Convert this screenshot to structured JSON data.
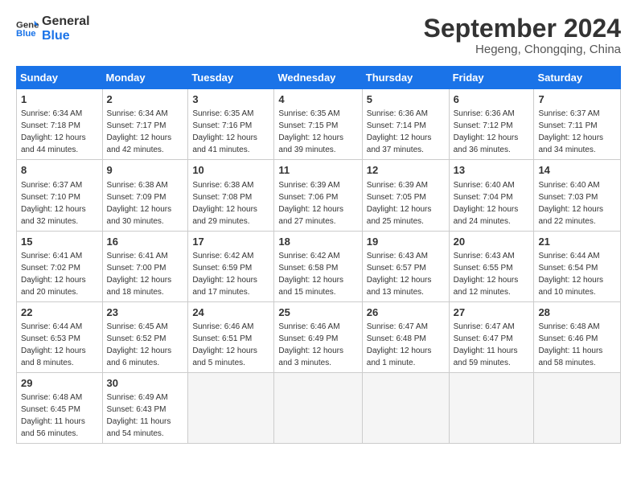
{
  "logo": {
    "text_general": "General",
    "text_blue": "Blue"
  },
  "header": {
    "month": "September 2024",
    "location": "Hegeng, Chongqing, China"
  },
  "weekdays": [
    "Sunday",
    "Monday",
    "Tuesday",
    "Wednesday",
    "Thursday",
    "Friday",
    "Saturday"
  ],
  "weeks": [
    [
      {
        "day": "1",
        "detail": "Sunrise: 6:34 AM\nSunset: 7:18 PM\nDaylight: 12 hours\nand 44 minutes."
      },
      {
        "day": "2",
        "detail": "Sunrise: 6:34 AM\nSunset: 7:17 PM\nDaylight: 12 hours\nand 42 minutes."
      },
      {
        "day": "3",
        "detail": "Sunrise: 6:35 AM\nSunset: 7:16 PM\nDaylight: 12 hours\nand 41 minutes."
      },
      {
        "day": "4",
        "detail": "Sunrise: 6:35 AM\nSunset: 7:15 PM\nDaylight: 12 hours\nand 39 minutes."
      },
      {
        "day": "5",
        "detail": "Sunrise: 6:36 AM\nSunset: 7:14 PM\nDaylight: 12 hours\nand 37 minutes."
      },
      {
        "day": "6",
        "detail": "Sunrise: 6:36 AM\nSunset: 7:12 PM\nDaylight: 12 hours\nand 36 minutes."
      },
      {
        "day": "7",
        "detail": "Sunrise: 6:37 AM\nSunset: 7:11 PM\nDaylight: 12 hours\nand 34 minutes."
      }
    ],
    [
      {
        "day": "8",
        "detail": "Sunrise: 6:37 AM\nSunset: 7:10 PM\nDaylight: 12 hours\nand 32 minutes."
      },
      {
        "day": "9",
        "detail": "Sunrise: 6:38 AM\nSunset: 7:09 PM\nDaylight: 12 hours\nand 30 minutes."
      },
      {
        "day": "10",
        "detail": "Sunrise: 6:38 AM\nSunset: 7:08 PM\nDaylight: 12 hours\nand 29 minutes."
      },
      {
        "day": "11",
        "detail": "Sunrise: 6:39 AM\nSunset: 7:06 PM\nDaylight: 12 hours\nand 27 minutes."
      },
      {
        "day": "12",
        "detail": "Sunrise: 6:39 AM\nSunset: 7:05 PM\nDaylight: 12 hours\nand 25 minutes."
      },
      {
        "day": "13",
        "detail": "Sunrise: 6:40 AM\nSunset: 7:04 PM\nDaylight: 12 hours\nand 24 minutes."
      },
      {
        "day": "14",
        "detail": "Sunrise: 6:40 AM\nSunset: 7:03 PM\nDaylight: 12 hours\nand 22 minutes."
      }
    ],
    [
      {
        "day": "15",
        "detail": "Sunrise: 6:41 AM\nSunset: 7:02 PM\nDaylight: 12 hours\nand 20 minutes."
      },
      {
        "day": "16",
        "detail": "Sunrise: 6:41 AM\nSunset: 7:00 PM\nDaylight: 12 hours\nand 18 minutes."
      },
      {
        "day": "17",
        "detail": "Sunrise: 6:42 AM\nSunset: 6:59 PM\nDaylight: 12 hours\nand 17 minutes."
      },
      {
        "day": "18",
        "detail": "Sunrise: 6:42 AM\nSunset: 6:58 PM\nDaylight: 12 hours\nand 15 minutes."
      },
      {
        "day": "19",
        "detail": "Sunrise: 6:43 AM\nSunset: 6:57 PM\nDaylight: 12 hours\nand 13 minutes."
      },
      {
        "day": "20",
        "detail": "Sunrise: 6:43 AM\nSunset: 6:55 PM\nDaylight: 12 hours\nand 12 minutes."
      },
      {
        "day": "21",
        "detail": "Sunrise: 6:44 AM\nSunset: 6:54 PM\nDaylight: 12 hours\nand 10 minutes."
      }
    ],
    [
      {
        "day": "22",
        "detail": "Sunrise: 6:44 AM\nSunset: 6:53 PM\nDaylight: 12 hours\nand 8 minutes."
      },
      {
        "day": "23",
        "detail": "Sunrise: 6:45 AM\nSunset: 6:52 PM\nDaylight: 12 hours\nand 6 minutes."
      },
      {
        "day": "24",
        "detail": "Sunrise: 6:46 AM\nSunset: 6:51 PM\nDaylight: 12 hours\nand 5 minutes."
      },
      {
        "day": "25",
        "detail": "Sunrise: 6:46 AM\nSunset: 6:49 PM\nDaylight: 12 hours\nand 3 minutes."
      },
      {
        "day": "26",
        "detail": "Sunrise: 6:47 AM\nSunset: 6:48 PM\nDaylight: 12 hours\nand 1 minute."
      },
      {
        "day": "27",
        "detail": "Sunrise: 6:47 AM\nSunset: 6:47 PM\nDaylight: 11 hours\nand 59 minutes."
      },
      {
        "day": "28",
        "detail": "Sunrise: 6:48 AM\nSunset: 6:46 PM\nDaylight: 11 hours\nand 58 minutes."
      }
    ],
    [
      {
        "day": "29",
        "detail": "Sunrise: 6:48 AM\nSunset: 6:45 PM\nDaylight: 11 hours\nand 56 minutes."
      },
      {
        "day": "30",
        "detail": "Sunrise: 6:49 AM\nSunset: 6:43 PM\nDaylight: 11 hours\nand 54 minutes."
      },
      {
        "day": "",
        "detail": ""
      },
      {
        "day": "",
        "detail": ""
      },
      {
        "day": "",
        "detail": ""
      },
      {
        "day": "",
        "detail": ""
      },
      {
        "day": "",
        "detail": ""
      }
    ]
  ]
}
